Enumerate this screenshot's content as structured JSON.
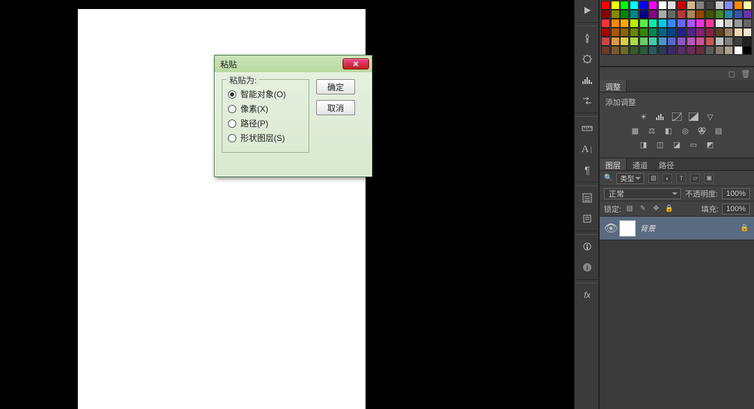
{
  "dialog": {
    "title": "粘贴",
    "group_title": "粘贴为:",
    "options": [
      {
        "label": "智能对象(O)",
        "checked": true
      },
      {
        "label": "像素(X)",
        "checked": false
      },
      {
        "label": "路径(P)",
        "checked": false
      },
      {
        "label": "形状图层(S)",
        "checked": false
      }
    ],
    "ok": "确定",
    "cancel": "取消"
  },
  "swatch_colors": [
    "#ff0000",
    "#ffff00",
    "#00ff00",
    "#00ffff",
    "#0000ff",
    "#ff00ff",
    "#ffffff",
    "#e0e0e0",
    "#cc0000",
    "#d2b48c",
    "#808080",
    "#404040",
    "#c8c8c8",
    "#8888ff",
    "#ff8800",
    "#ffffaa",
    "#880000",
    "#888800",
    "#008800",
    "#008888",
    "#000088",
    "#880088",
    "#aaaaaa",
    "#666666",
    "#b83838",
    "#aa8855",
    "#994400",
    "#445500",
    "#448822",
    "#2288aa",
    "#3355aa",
    "#6633aa",
    "#ff3333",
    "#ff8800",
    "#ffaa00",
    "#bbee00",
    "#55ee44",
    "#00eeaa",
    "#00ccee",
    "#3388ff",
    "#6666ff",
    "#aa55ff",
    "#ee33dd",
    "#ff3399",
    "#eeeeee",
    "#cccccc",
    "#999999",
    "#666666",
    "#aa0000",
    "#aa5500",
    "#886600",
    "#668800",
    "#338800",
    "#008855",
    "#006688",
    "#004488",
    "#222288",
    "#552288",
    "#882277",
    "#882244",
    "#604020",
    "#a08060",
    "#eed8b0",
    "#f0e8d0",
    "#cc4444",
    "#dd9944",
    "#ddcc44",
    "#aadd44",
    "#66cc66",
    "#44ccaa",
    "#4499cc",
    "#5566cc",
    "#8855cc",
    "#bb55bb",
    "#cc5599",
    "#cc5555",
    "#c0c0c0",
    "#808080",
    "#404040",
    "#202020",
    "#6a3a2a",
    "#7a5a2a",
    "#6a6a2a",
    "#3a5a2a",
    "#2a5a3a",
    "#2a5a5a",
    "#2a3a5a",
    "#3a2a6a",
    "#5a2a6a",
    "#6a2a5a",
    "#6a2a3a",
    "#5a5a5a",
    "#8a7a6a",
    "#b0a090",
    "#ffffff",
    "#000000"
  ],
  "adjustments": {
    "tab": "调整",
    "title": "添加调整"
  },
  "layers_panel": {
    "tabs": [
      "图层",
      "通道",
      "路径"
    ],
    "filter_label": "类型",
    "blend_mode": "正常",
    "opacity_label": "不透明度:",
    "opacity_value": "100%",
    "fill_label": "填充:",
    "fill_value": "100%",
    "lock_label": "锁定:",
    "layer_name": "背景"
  }
}
